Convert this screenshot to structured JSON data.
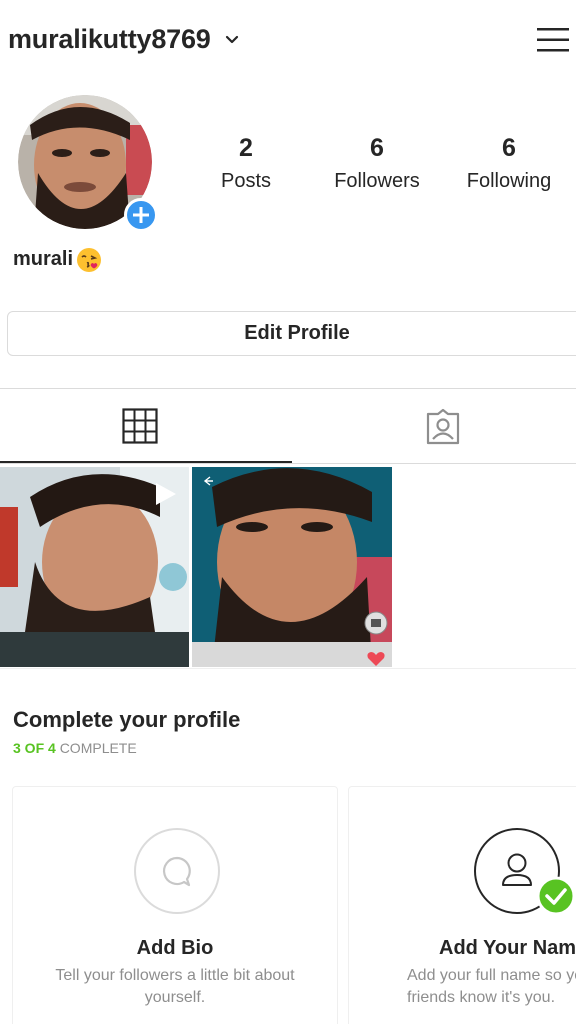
{
  "header": {
    "username": "muralikutty8769",
    "dropdown_icon": "chevron-down-icon",
    "menu_icon": "hamburger-menu-icon"
  },
  "profile": {
    "display_name": "murali",
    "stats": {
      "posts": {
        "count": "2",
        "label": "Posts"
      },
      "followers": {
        "count": "6",
        "label": "Followers"
      },
      "following": {
        "count": "6",
        "label": "Following"
      }
    },
    "edit_button": "Edit Profile"
  },
  "tabs": [
    {
      "icon": "grid-icon",
      "active": true
    },
    {
      "icon": "tagged-person-icon",
      "active": false
    }
  ],
  "complete_profile": {
    "title": "Complete your profile",
    "progress_done": "3 OF 4",
    "progress_rest": "COMPLETE",
    "cards": [
      {
        "title": "Add Bio",
        "description": "Tell your followers a little bit about yourself.",
        "icon": "speech-bubble-icon",
        "completed": false
      },
      {
        "title": "Add Your Name",
        "description": "Add your full name so your friends know it's you.",
        "icon": "person-icon",
        "completed": true
      }
    ]
  },
  "colors": {
    "accent_blue": "#3897f0",
    "complete_green": "#58c322",
    "like_pink": "#ed4956",
    "text": "#262626",
    "muted": "#8e8e8e"
  }
}
